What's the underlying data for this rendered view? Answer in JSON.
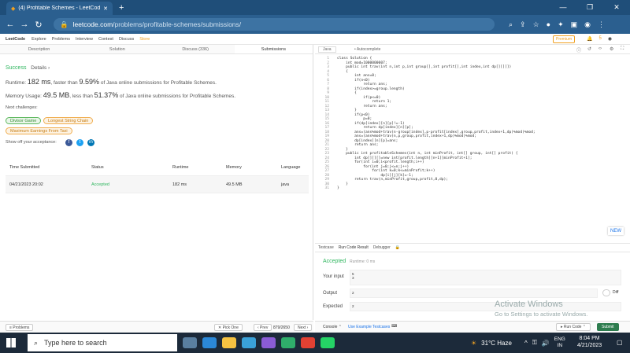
{
  "browser": {
    "tab_title": "(4) Profitable Schemes - LeetCod",
    "close": "✕",
    "new_tab": "+",
    "url_host": "leetcode.com",
    "url_path": "/problems/profitable-schemes/submissions/",
    "win_min": "—",
    "win_max": "❐",
    "win_close": "✕"
  },
  "lcnav": {
    "logo": "LeetCode",
    "items": [
      "Explore",
      "Problems",
      "Interview",
      "Contest",
      "Discuss"
    ],
    "store": "Store",
    "premium": "Premium",
    "coins": "5"
  },
  "left_tabs": [
    "Description",
    "Solution",
    "Discuss (336)",
    "Submissions"
  ],
  "summary": {
    "success": "Success",
    "details": "Details ›",
    "runtime_prefix": "Runtime:",
    "runtime": "182 ms",
    "runtime_mid": ", faster than",
    "runtime_pct": "9.59%",
    "runtime_suffix": "of Java online submissions for Profitable Schemes.",
    "memory_prefix": "Memory Usage:",
    "memory": "49.5 MB",
    "memory_mid": ", less than",
    "memory_pct": "51.37%",
    "memory_suffix": "of Java online submissions for Profitable Schemes.",
    "next": "Next challenges:",
    "challenges": [
      "Divisor Game",
      "Longest String Chain",
      "Maximum Earnings From Taxi"
    ],
    "share": "Show off your acceptance:"
  },
  "table": {
    "headers": [
      "Time Submitted",
      "Status",
      "Runtime",
      "Memory",
      "Language"
    ],
    "rows": [
      [
        "04/21/2023 20:02",
        "Accepted",
        "182 ms",
        "49.5 MB",
        "java"
      ]
    ]
  },
  "left_footer": {
    "problems": "≡ Problems",
    "pick": "✕ Pick One",
    "prev": "‹ Prev",
    "page": "879/2650",
    "next": "Next ›"
  },
  "editor": {
    "language": "Java",
    "autocomplete": "• Autocomplete",
    "lines": [
      "class Solution {",
      "    int mod=1000000007;",
      "    public int trav(int n,int p,int group[],int profit[],int index,int dp[][][])",
      "    {",
      "        int ans=0;",
      "        if(n<0)",
      "            return ans;",
      "        if(index>=group.length)",
      "        {",
      "            if(p<=0)",
      "                return 1;",
      "            return ans;",
      "        }",
      "        if(p<0)",
      "            p=0;",
      "        if(dp[index][n][p]!=-1)",
      "            return dp[index][n][p];",
      "        ans=(ans%mod+trav(n-group[index],p-profit[index],group,profit,index+1,dp)%mod)%mod;",
      "        ans=(ans%mod+trav(n,p,group,profit,index+1,dp)%mod)%mod;",
      "        dp[index][n][p]=ans;",
      "        return ans;",
      "    }",
      "    public int profitableSchemes(int n, int minProfit, int[] group, int[] profit) {",
      "        int dp[][][]=new int[profit.length][n+1][minProfit+1];",
      "        for(int i=0;i<profit.length;i++)",
      "            for(int j=0;j<=n;j++)",
      "                for(int k=0;k<=minProfit;k++)",
      "                    dp[i][j][k]=-1;",
      "        return trav(n,minProfit,group,profit,0,dp);",
      "    }",
      "}"
    ],
    "new_label": "NEW"
  },
  "results": {
    "tabs": [
      "Testcase",
      "Run Code Result",
      "Debugger"
    ],
    "accepted": "Accepted",
    "runtime": "Runtime: 0 ms",
    "your_input": "Your input",
    "input_lines": [
      "5",
      "3"
    ],
    "output": "Output",
    "output_value": "2",
    "diff": "Diff",
    "expected": "Expected",
    "expected_value": "2"
  },
  "right_footer": {
    "console": "Console ⌃",
    "example": "Use Example Testcases",
    "run": "▸ Run Code ⌃",
    "submit": "Submit"
  },
  "watermark": {
    "line1": "Activate Windows",
    "line2": "Go to Settings to activate Windows."
  },
  "taskbar": {
    "search_placeholder": "Type here to search",
    "weather": "31°C  Haze",
    "lang": "ENG",
    "region": "IN",
    "time": "8:04 PM",
    "date": "4/21/2023"
  }
}
